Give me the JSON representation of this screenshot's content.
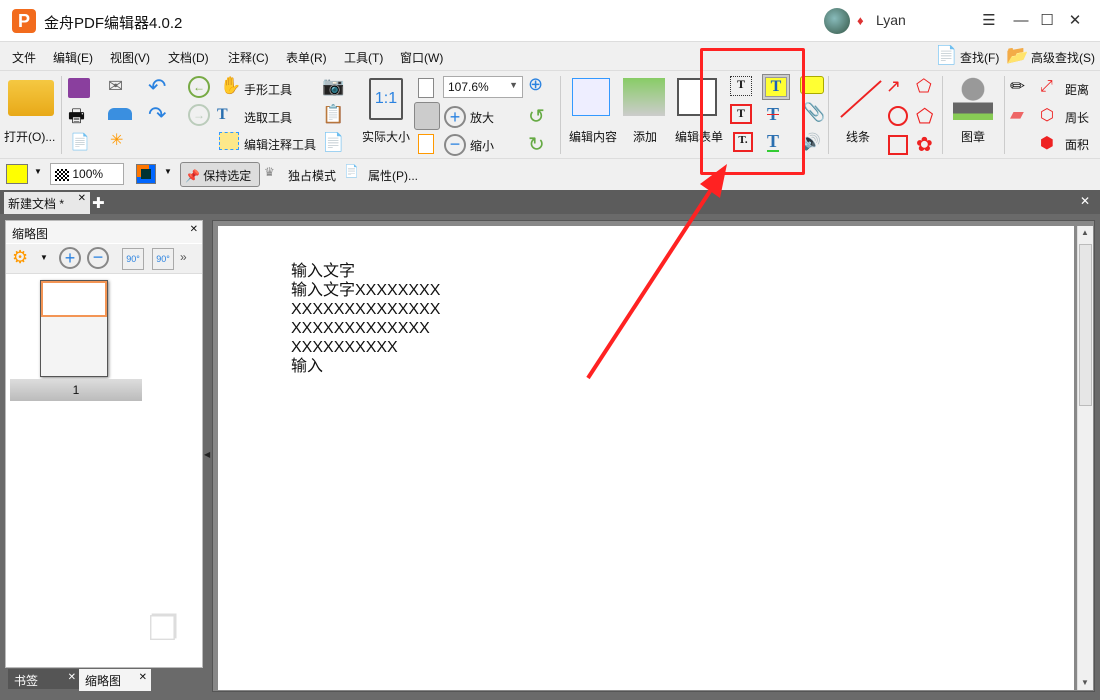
{
  "window": {
    "title": "金舟PDF编辑器4.0.2",
    "user": "Lyan"
  },
  "menu": [
    "文件",
    "编辑(E)",
    "视图(V)",
    "文档(D)",
    "注释(C)",
    "表单(R)",
    "工具(T)",
    "窗口(W)"
  ],
  "search": {
    "find": "查找(F)",
    "advanced": "高级查找(S)"
  },
  "toolbar": {
    "open": "打开(O)...",
    "hand": "手形工具",
    "select": "选取工具",
    "edit_annot": "编辑注释工具",
    "actual_size": "实际大小",
    "zoom_value": "107.6%",
    "zoom_in": "放大",
    "zoom_out": "缩小",
    "edit_content": "编辑内容",
    "add": "添加",
    "edit_form": "编辑表单",
    "lines": "线条",
    "stamp": "图章",
    "distance": "距离",
    "perimeter": "周长",
    "area": "面积"
  },
  "row2": {
    "opacity": "100%",
    "keep_selected": "保持选定",
    "exclusive": "独占模式",
    "properties": "属性(P)...",
    "fill_color": "#ffff00"
  },
  "tabs": {
    "doc": "新建文档 *"
  },
  "panel": {
    "title": "缩略图",
    "page_num": "1",
    "bottom_tabs": [
      "书签",
      "缩略图"
    ]
  },
  "document": {
    "lines": [
      "输入文字",
      "输入文字XXXXXXXX",
      "XXXXXXXXXXXXXX",
      "XXXXXXXXXXXXX",
      "XXXXXXXXXX",
      "输入"
    ]
  },
  "annotation": {
    "highlight_color": "#ff2222"
  }
}
